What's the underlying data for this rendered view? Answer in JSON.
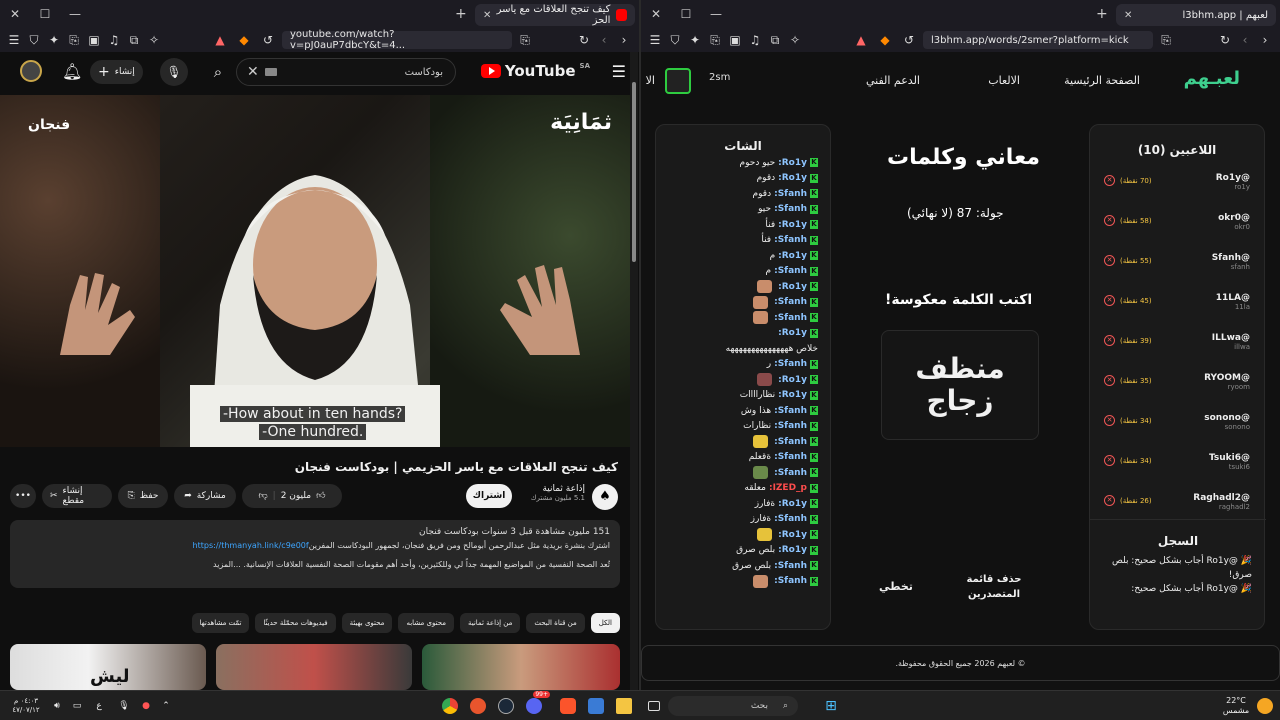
{
  "left_browser": {
    "tab_title": "كيف تنجح العلاقات مع ياسر الحز",
    "url": "youtube.com/watch?v=pJ0auP7dbcY&t=4...",
    "youtube": {
      "logo_text": "YouTube",
      "logo_region": "SA",
      "search_value": "بودكاست",
      "create_label": "إنشاء",
      "video_brand_right": "ثمَانِيَة",
      "video_brand_left": "فنجان",
      "subtitle_line1": "-How about in ten hands?",
      "subtitle_line2": "-One hundred.",
      "video_title": "كيف تنجح العلاقات مع ياسر الحزيمي | بودكاست فنجان",
      "channel_name": "إذاعة ثمانية",
      "channel_subs": "5.1 مليون مشترك",
      "subscribe_label": "اشتراك",
      "likes_label": "2 مليون",
      "share_label": "مشاركة",
      "save_label": "حفظ",
      "clip_label": "إنشاء مقطع",
      "desc_stats": "151 مليون مشاهدة  قبل 3 سنوات  بودكاست فنجان",
      "desc_line1": "اشترك بنشرة بريدية مثل عبدالرحمن أبومالح ومن فريق فنجان، لجمهور البودكاست المفرين",
      "desc_link": "https://thmanyah.link/c9e00f",
      "desc_line2": "تُعد الصحة النفسية من المواضيع المهمة جداً لي وللكثيرين، وأحد أهم مقومات الصحة النفسية العلاقات الإنسانية. ...المزيد",
      "chips": [
        "الكل",
        "من قناة البحث",
        "من إذاعة ثمانية",
        "محتوى مشابه",
        "محتوى بهيئة",
        "فيديوهات محمّلة حديثًا",
        "تمّت مشاهدتها"
      ],
      "thumb_text": "ليش"
    }
  },
  "right_browser": {
    "tab_title": "لعبهم | l3bhm.app",
    "url": "l3bhm.app/words/2smer?platform=kick",
    "site": {
      "logo": "لعبـهم",
      "nav": [
        "الصفحة الرئيسية",
        "الالعاب",
        "الدعم الفني",
        "الا"
      ],
      "user_label": "2sm",
      "players_title": "اللاعبين (10)",
      "players": [
        {
          "name": "@Ro1y",
          "handle": "ro1y",
          "points": "(70 نقطة)"
        },
        {
          "name": "@okr0",
          "handle": "okr0",
          "points": "(58 نقطة)"
        },
        {
          "name": "@Sfanh",
          "handle": "sfanh",
          "points": "(55 نقطة)"
        },
        {
          "name": "@11LA",
          "handle": "11la",
          "points": "(45 نقطة)"
        },
        {
          "name": "@ILLwa",
          "handle": "illwa",
          "points": "(39 نقطة)"
        },
        {
          "name": "@RYOOM",
          "handle": "ryoom",
          "points": "(35 نقطة)"
        },
        {
          "name": "@sonono",
          "handle": "sonono",
          "points": "(34 نقطة)"
        },
        {
          "name": "@Tsuki6",
          "handle": "tsuki6",
          "points": "(34 نقطة)"
        },
        {
          "name": "@Raghadl2",
          "handle": "raghadl2",
          "points": "(26 نقطة)"
        }
      ],
      "game_title": "معاني وكلمات",
      "round_label": "جولة: 87 (لا نهائي)",
      "instruction": "اكتب الكلمة معكوسة!",
      "word_line1": "منظف",
      "word_line2": "زجاج",
      "skip_label": "تخطي",
      "clear_label": "حذف قائمة المتصدرين",
      "log_title": "السجل",
      "log_entries": [
        "🎉 @Ro1y أجاب بشكل صحيح: بلص صرق!",
        "🎉 @Ro1y أجاب بشكل صحيح:"
      ],
      "chat_title": "الشات",
      "chat": [
        {
          "user": "Ro1y:",
          "msg": "حيو دحوم"
        },
        {
          "user": "Ro1y:",
          "msg": "دقوم"
        },
        {
          "user": "Sfanh:",
          "msg": "دقوم"
        },
        {
          "user": "Sfanh:",
          "msg": "حيو"
        },
        {
          "user": "Ro1y:",
          "msg": "فنأ"
        },
        {
          "user": "Sfanh:",
          "msg": "فنأ"
        },
        {
          "user": "Ro1y:",
          "msg": "م"
        },
        {
          "user": "Sfanh:",
          "msg": "م"
        },
        {
          "user": "Ro1y:",
          "msg": "",
          "emoji": "#c98d6b"
        },
        {
          "user": "Sfanh:",
          "msg": "",
          "emoji": "#c98d6b"
        },
        {
          "user": "Sfanh:",
          "msg": "",
          "emoji": "#c98d6b"
        },
        {
          "user": "Ro1y:",
          "msg": ""
        },
        {
          "user": "",
          "msg": "خلاص هههههههههههههههه"
        },
        {
          "user": "Sfanh:",
          "msg": "ر"
        },
        {
          "user": "Ro1y:",
          "msg": "",
          "emoji": "#8a4a4a"
        },
        {
          "user": "Ro1y:",
          "msg": "نظاراااات"
        },
        {
          "user": "Sfanh:",
          "msg": "هذا وش"
        },
        {
          "user": "Sfanh:",
          "msg": "نظارات"
        },
        {
          "user": "Sfanh:",
          "msg": "",
          "emoji": "#e6c23a"
        },
        {
          "user": "Sfanh:",
          "msg": "ةقعلم"
        },
        {
          "user": "Sfanh:",
          "msg": "",
          "emoji": "#6a8a4a"
        },
        {
          "user": "IZED_p:",
          "msg": "معلقه",
          "red": true
        },
        {
          "user": "Ro1y:",
          "msg": "ةفارز"
        },
        {
          "user": "Sfanh:",
          "msg": "ةفارز"
        },
        {
          "user": "Ro1y:",
          "msg": "",
          "emoji": "#e6c23a"
        },
        {
          "user": "Ro1y:",
          "msg": "بلص صرق"
        },
        {
          "user": "Sfanh:",
          "msg": "بلص صرق"
        },
        {
          "user": "Sfanh:",
          "msg": "",
          "emoji": "#c98d6b"
        }
      ],
      "footer": "© لعبهم 2026 جميع الحقوق محفوظة."
    }
  },
  "taskbar": {
    "search_placeholder": "بحث",
    "weather_temp": "22°C",
    "weather_desc": "مشمس",
    "time": "٠٤:٠٣ م",
    "date": "٤٧/٠٧/١٢",
    "lang": "ع",
    "badge": "99+"
  },
  "colors": {
    "youtube_red": "#ff0000",
    "kick_green": "#2ecc40",
    "points_gold": "#f5c542"
  }
}
